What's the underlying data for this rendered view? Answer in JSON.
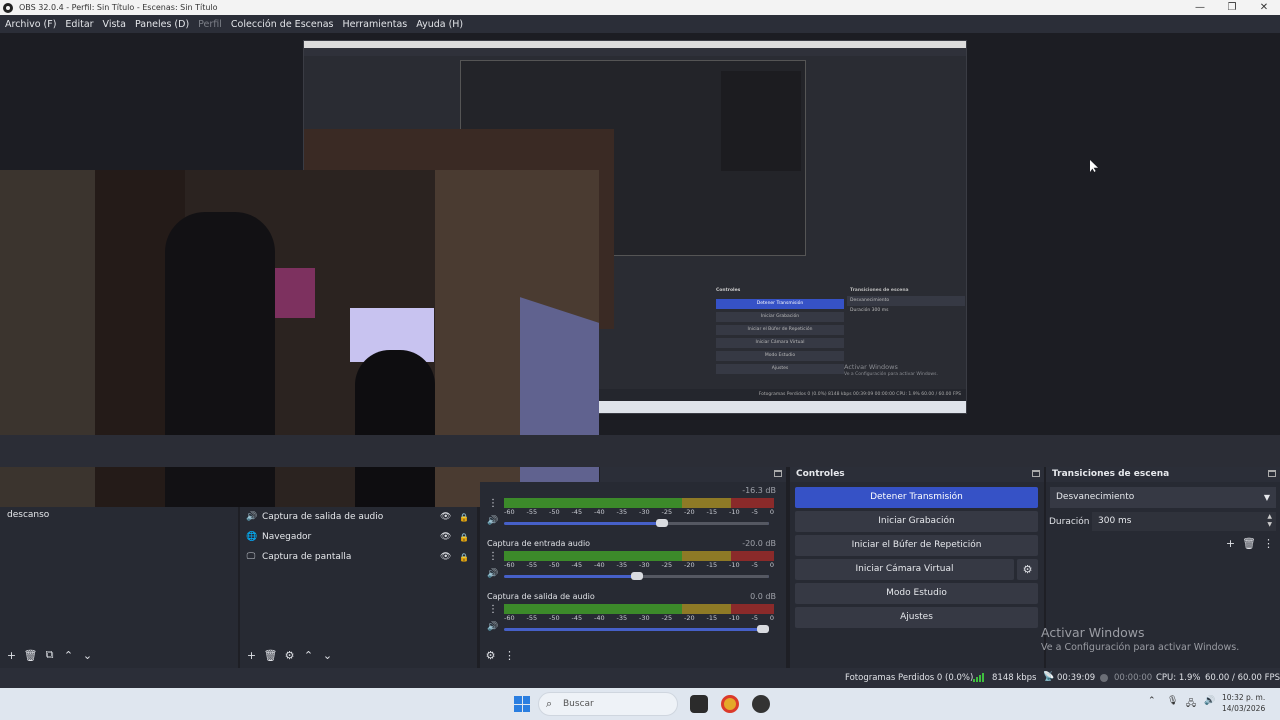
{
  "window": {
    "title": "OBS 32.0.4 - Perfil: Sin Título - Escenas: Sin Título",
    "controls": [
      "—",
      "❐",
      "✕"
    ]
  },
  "menu": [
    {
      "label": "Archivo (F)",
      "enabled": true
    },
    {
      "label": "Editar",
      "enabled": true
    },
    {
      "label": "Vista",
      "enabled": true
    },
    {
      "label": "Paneles (D)",
      "enabled": true
    },
    {
      "label": "Perfil",
      "enabled": false
    },
    {
      "label": "Colección de Escenas",
      "enabled": true
    },
    {
      "label": "Herramientas",
      "enabled": true
    },
    {
      "label": "Ayuda (H)",
      "enabled": true
    }
  ],
  "preview": {
    "nested": {
      "status": "Fotogramas Perdidos 0 (0.0%)   8148 kbps   00:39:09   00:00:00   CPU: 1.9%   60.00 / 60.00 FPS",
      "watermark_1": "Activar Windows",
      "watermark_2": "Ve a Configuración para activar Windows.",
      "btn_stop": "Detener Transmisión",
      "btn_rec": "Iniciar Grabación",
      "btn_replay": "Iniciar el Búfer de Repetición",
      "btn_vcam": "Iniciar Cámara Virtual",
      "btn_studio": "Modo Estudio",
      "btn_settings": "Ajustes",
      "trans_select": "Desvanecimiento",
      "trans_dur": "Duración   300 ms",
      "hdr_controls": "Controles",
      "hdr_trans": "Transiciones de escena"
    }
  },
  "scenes": {
    "items": [
      "descanso"
    ],
    "footer_icons": [
      "+",
      "🗑",
      "⧉",
      "⌃",
      "⌄"
    ]
  },
  "sources": {
    "items": [
      {
        "name": "Captura de salida de audio",
        "icon": "speaker-icon"
      },
      {
        "name": "Navegador",
        "icon": "globe-icon"
      },
      {
        "name": "Captura de pantalla",
        "icon": "monitor-icon"
      }
    ],
    "footer_icons": [
      "+",
      "🗑",
      "⚙",
      "⌃",
      "⌄"
    ]
  },
  "mixer": {
    "header_menu": "⧉",
    "tracks": [
      {
        "name": "",
        "db": "-16.3 dB",
        "volume": 0.6
      },
      {
        "name": "Captura de entrada audio",
        "db": "-20.0 dB",
        "volume": 0.5
      },
      {
        "name": "Captura de salida de audio",
        "db": "0.0 dB",
        "volume": 1.0
      }
    ],
    "scale": [
      "-60",
      "-55",
      "-50",
      "-45",
      "-40",
      "-35",
      "-30",
      "-25",
      "-20",
      "-15",
      "-10",
      "-5",
      "0"
    ],
    "footer_icons": [
      "⚙",
      "⋮"
    ]
  },
  "controls": {
    "header": "Controles",
    "stop_stream": "Detener Transmisión",
    "start_recording": "Iniciar Grabación",
    "start_replay": "Iniciar el Búfer de Repetición",
    "start_vcam": "Iniciar Cámara Virtual",
    "studio_mode": "Modo Estudio",
    "settings": "Ajustes"
  },
  "transitions": {
    "header": "Transiciones de escena",
    "selected": "Desvanecimiento",
    "duration_label": "Duración",
    "duration_value": "300 ms"
  },
  "watermark": {
    "line1": "Activar Windows",
    "line2": "Ve a Configuración para activar Windows."
  },
  "status": {
    "dropped": "Fotogramas Perdidos 0 (0.0%)",
    "bitrate": "8148 kbps",
    "stream_time": "00:39:09",
    "rec_time": "00:00:00",
    "cpu": "CPU: 1.9%",
    "fps": "60.00 / 60.00 FPS"
  },
  "taskbar": {
    "search_placeholder": "Buscar",
    "time": "10:32 p. m.",
    "date": "14/03/2026"
  },
  "colors": {
    "accent": "#3652c6",
    "meter_green": "#3c8a2a",
    "meter_yellow": "#8e7a26",
    "meter_red": "#8a2a2a"
  }
}
